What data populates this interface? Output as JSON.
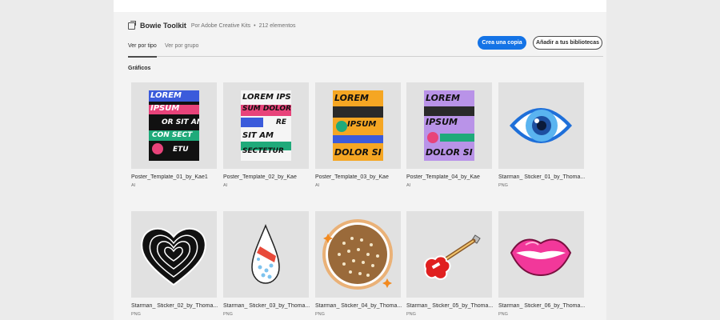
{
  "header": {
    "title": "Bowie Toolkit",
    "byline": "Por Adobe Creative Kits",
    "count": "212 elementos",
    "icon": "library-icon"
  },
  "actions": {
    "copy_label": "Crea una copia",
    "add_label": "Añadir a tus bibliotecas"
  },
  "tabs": [
    {
      "label": "Ver por tipo",
      "active": true
    },
    {
      "label": "Ver por grupo",
      "active": false
    }
  ],
  "section_title": "Gráficos",
  "assets": [
    {
      "name": "Poster_Template_01_by_Kae1",
      "type": "AI"
    },
    {
      "name": "Poster_Template_02_by_Kae",
      "type": "AI"
    },
    {
      "name": "Poster_Template_03_by_Kae",
      "type": "AI"
    },
    {
      "name": "Poster_Template_04_by_Kae",
      "type": "AI"
    },
    {
      "name": "Starman_ Sticker_01_by_Thoma...",
      "type": "PNG"
    },
    {
      "name": "Starman_ Sticker_02_by_Thoma...",
      "type": "PNG"
    },
    {
      "name": "Starman_ Sticker_03_by_Thoma...",
      "type": "PNG"
    },
    {
      "name": "Starman_ Sticker_04_by_Thoma...",
      "type": "PNG"
    },
    {
      "name": "Starman_ Sticker_05_by_Thoma...",
      "type": "PNG"
    },
    {
      "name": "Starman_ Sticker_06_by_Thoma...",
      "type": "PNG"
    }
  ],
  "posters": [
    {
      "bg": "#111111",
      "words": [
        "LOREM",
        "IPSUM",
        "OR SIT AM",
        "CON SECT",
        "ETU"
      ]
    },
    {
      "bg": "#f5f5f5",
      "words": [
        "LOREM IPS",
        "SUM DOLOR",
        "RE",
        "SIT AM",
        "SECTETUR"
      ]
    },
    {
      "bg": "#f5a623",
      "words": [
        "LOREM",
        "IPSUM",
        "DOLOR SI"
      ]
    },
    {
      "bg": "#b993e8",
      "words": [
        "LOREM",
        "IPSUM",
        "DOLOR SI"
      ]
    }
  ],
  "colors": {
    "accent": "#1473e6",
    "background": "#f3f3f3",
    "thumb": "#e1e1e1"
  }
}
